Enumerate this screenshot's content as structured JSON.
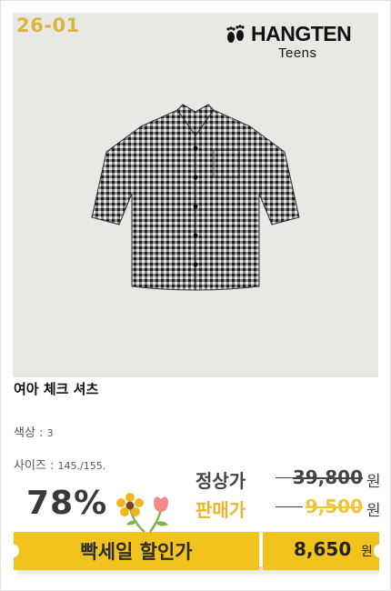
{
  "image": {
    "code": "26-01",
    "brand_name": "HANGTEN",
    "brand_sub": "Teens"
  },
  "product": {
    "name": "여아 체크 셔츠",
    "color_label": "색상 :",
    "color_value": "3",
    "size_label": "사이즈 :",
    "size_value": "145./155."
  },
  "pricing": {
    "discount": "78%",
    "regular_label": "정상가",
    "regular_price": "39,800",
    "sale_label": "판매가",
    "sale_price": "9,500",
    "unit": "원"
  },
  "banner": {
    "left_text": "빡세일 할인가",
    "final_price": "8,650",
    "unit": "원"
  },
  "colors": {
    "accent_yellow": "#f2c31c",
    "code_gold": "#d9b540",
    "sale_yellow": "#f3c533",
    "image_bg": "#e8e8e4"
  },
  "icons": [
    "footprint-icon",
    "flower-icon"
  ]
}
